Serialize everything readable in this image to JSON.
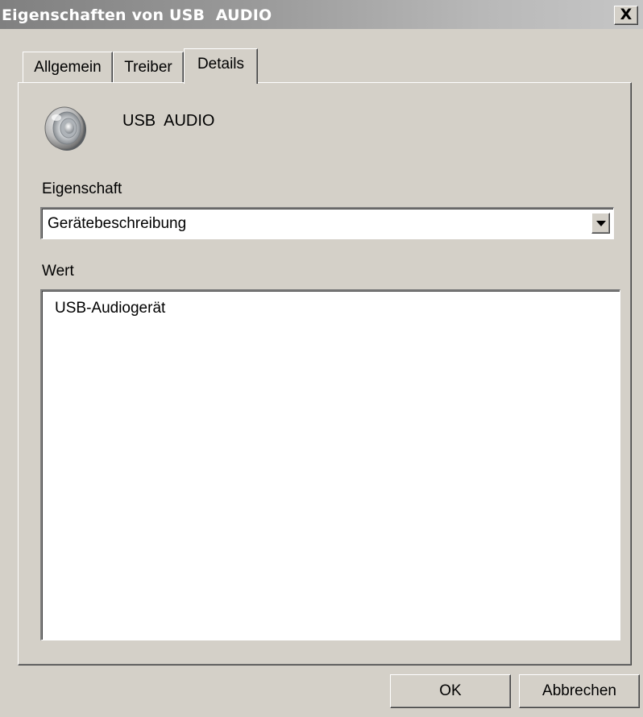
{
  "window": {
    "title": "Eigenschaften von USB  AUDIO",
    "close_label": "X"
  },
  "tabs": [
    {
      "label": "Allgemein",
      "active": false
    },
    {
      "label": "Treiber",
      "active": false
    },
    {
      "label": "Details",
      "active": true
    }
  ],
  "device": {
    "icon": "speaker-icon",
    "name": "USB  AUDIO"
  },
  "property": {
    "label": "Eigenschaft",
    "selected": "Gerätebeschreibung"
  },
  "value": {
    "label": "Wert",
    "items": [
      "USB-Audiogerät"
    ]
  },
  "buttons": {
    "ok": "OK",
    "cancel": "Abbrechen"
  }
}
